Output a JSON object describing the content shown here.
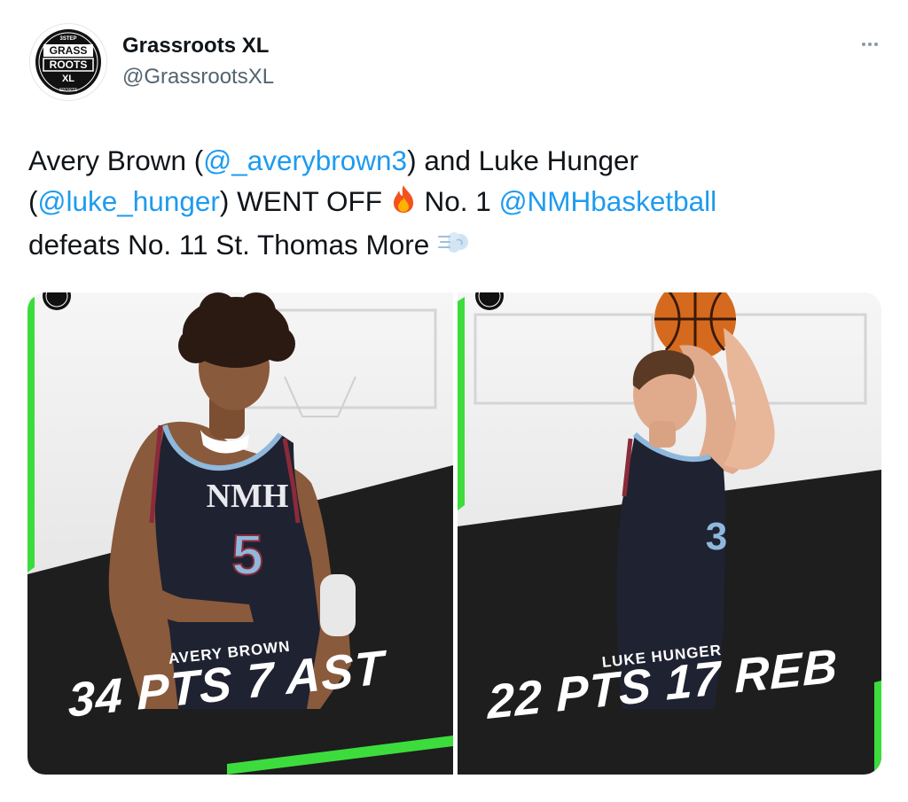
{
  "tweet": {
    "display_name": "Grassroots XL",
    "handle": "@GrassrootsXL",
    "text": {
      "l1_a": "Avery Brown (",
      "l1_mention": "@_averybrown3",
      "l1_b": ") and Luke Hunger",
      "l2_a": "(",
      "l2_mention": "@luke_hunger",
      "l2_b": ") WENT OFF ",
      "l2_c": " No. 1 ",
      "l2_mention2": "@NMHbasketball",
      "l3_a": "defeats No. 11 St. Thomas More "
    }
  },
  "avatar_logo": {
    "top": "3STEP",
    "line1": "GRASS",
    "line2": "ROOTS",
    "line3": "XL",
    "bottom": "SPORTS"
  },
  "media": {
    "left_card": {
      "jersey_text": "NMH",
      "jersey_number": "5",
      "player_name": "AVERY BROWN",
      "stats": "34 PTS 7 AST"
    },
    "right_card": {
      "jersey_number": "3",
      "player_name": "LUKE HUNGER",
      "stats": "22 PTS 17 REB"
    }
  },
  "colors": {
    "accent_green": "#3ddc3d",
    "card_dark": "#1e1e1e",
    "link_blue": "#1d9bf0",
    "jersey_navy": "#1f2230",
    "jersey_blue": "#8fb8dd",
    "jersey_maroon": "#8b2a3a"
  },
  "icons": {
    "more": "more-dots-icon",
    "fire": "fire-emoji-icon",
    "dash": "dash-emoji-icon"
  }
}
